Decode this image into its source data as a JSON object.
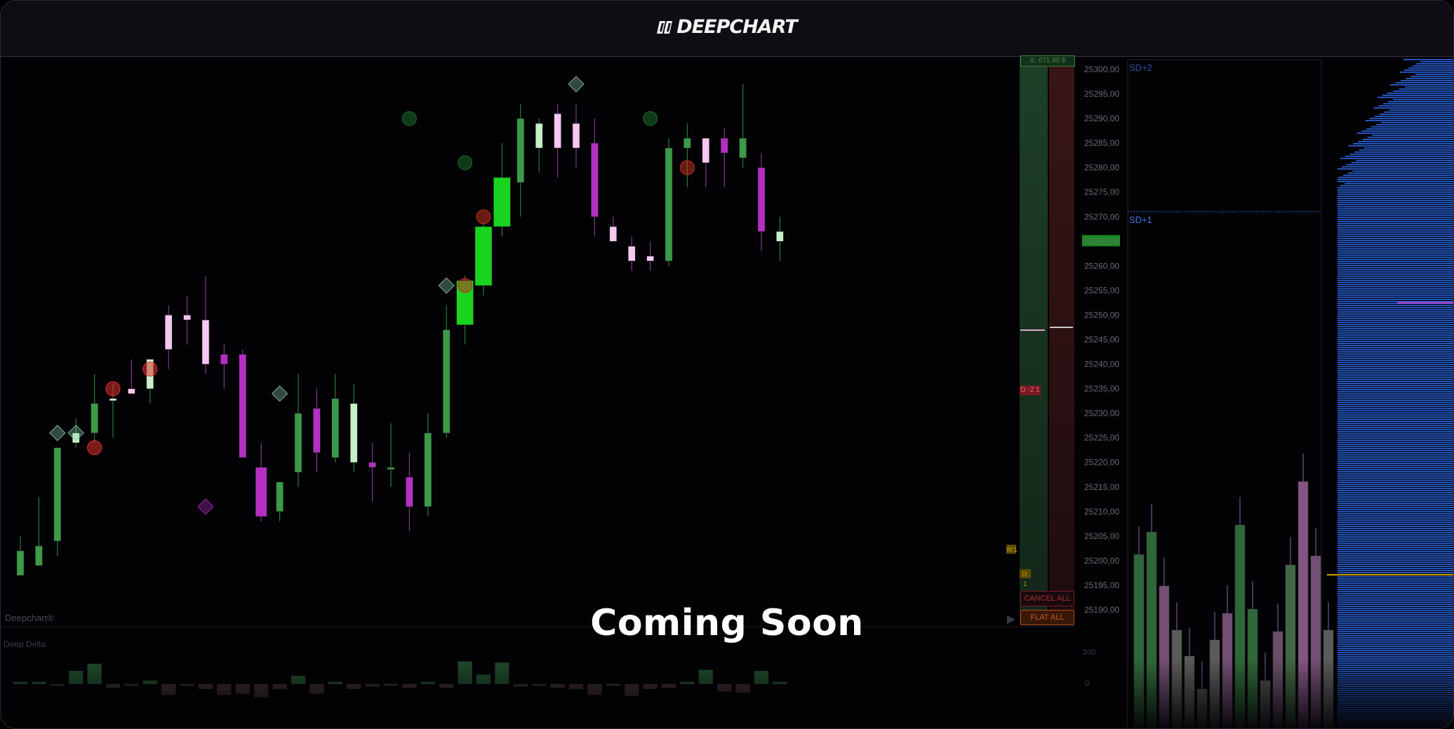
{
  "app": {
    "title": "DEEPCHART",
    "watermark": "Deepchart®",
    "overlay_text": "Coming Soon"
  },
  "colors": {
    "bull": "#3c9a48",
    "bull_bright": "#19d41f",
    "bear": "#b42fc2",
    "bear_light": "#f4c8f1",
    "bull_light": "#c8f0c8",
    "profile": "#2a62d8",
    "poc": "#c8a400"
  },
  "subpanel": {
    "title": "Deep Delta",
    "axis_labels": [
      "200",
      "0"
    ]
  },
  "order_panel": {
    "pnl_label": "Δ: 671,90 $",
    "position_tag": "D -2 1",
    "cancel_all_label": "CANCEL ALL",
    "flat_all_label": "FLAT ALL",
    "qty_tag_1": "W:1",
    "qty_tag_2": "D: 1"
  },
  "price_axis": {
    "labels": [
      "25300,00",
      "25295,00",
      "25290,00",
      "25285,00",
      "25280,00",
      "25275,00",
      "25270,00",
      "25265,00",
      "25260,00",
      "25255,00",
      "25250,00",
      "25245,00",
      "25240,00",
      "25235,00",
      "25230,00",
      "25225,00",
      "25220,00",
      "25215,00",
      "25210,00",
      "25205,00",
      "25200,00",
      "25195,00",
      "25190,00"
    ],
    "current_price": "25265,00"
  },
  "bands": {
    "sd2": "SD+2",
    "sd1": "SD+1"
  },
  "chart_data": {
    "type": "candlestick",
    "ylim": [
      25187,
      25302
    ],
    "candles": [
      {
        "o": 25197,
        "h": 25205,
        "l": 25197,
        "c": 25202,
        "s": "g"
      },
      {
        "o": 25199,
        "h": 25213,
        "l": 25199,
        "c": 25203,
        "s": "g"
      },
      {
        "o": 25204,
        "h": 25223,
        "l": 25201,
        "c": 25223,
        "s": "g"
      },
      {
        "o": 25224,
        "h": 25229,
        "l": 25223,
        "c": 25226,
        "s": "gl"
      },
      {
        "o": 25226,
        "h": 25238,
        "l": 25224,
        "c": 25232,
        "s": "g"
      },
      {
        "o": 25233,
        "h": 25236,
        "l": 25225,
        "c": 25233,
        "s": "w"
      },
      {
        "o": 25234,
        "h": 25241,
        "l": 25234,
        "c": 25235,
        "s": "pl"
      },
      {
        "o": 25235,
        "h": 25240,
        "l": 25232,
        "c": 25241,
        "s": "gl"
      },
      {
        "o": 25250,
        "h": 25252,
        "l": 25239,
        "c": 25243,
        "s": "pl"
      },
      {
        "o": 25249,
        "h": 25254,
        "l": 25244,
        "c": 25250,
        "s": "pl"
      },
      {
        "o": 25249,
        "h": 25258,
        "l": 25238,
        "c": 25240,
        "s": "pl"
      },
      {
        "o": 25242,
        "h": 25244,
        "l": 25235,
        "c": 25240,
        "s": "p"
      },
      {
        "o": 25242,
        "h": 25243,
        "l": 25221,
        "c": 25221,
        "s": "p"
      },
      {
        "o": 25219,
        "h": 25224,
        "l": 25208,
        "c": 25209,
        "s": "p"
      },
      {
        "o": 25210,
        "h": 25216,
        "l": 25208,
        "c": 25216,
        "s": "g"
      },
      {
        "o": 25218,
        "h": 25238,
        "l": 25215,
        "c": 25230,
        "s": "g"
      },
      {
        "o": 25231,
        "h": 25235,
        "l": 25218,
        "c": 25222,
        "s": "p"
      },
      {
        "o": 25221,
        "h": 25238,
        "l": 25220,
        "c": 25233,
        "s": "g"
      },
      {
        "o": 25232,
        "h": 25236,
        "l": 25218,
        "c": 25220,
        "s": "gl"
      },
      {
        "o": 25220,
        "h": 25224,
        "l": 25212,
        "c": 25219,
        "s": "p"
      },
      {
        "o": 25219,
        "h": 25228,
        "l": 25215,
        "c": 25219,
        "s": "g"
      },
      {
        "o": 25217,
        "h": 25222,
        "l": 25206,
        "c": 25211,
        "s": "p"
      },
      {
        "o": 25211,
        "h": 25230,
        "l": 25209,
        "c": 25226,
        "s": "g"
      },
      {
        "o": 25226,
        "h": 25252,
        "l": 25225,
        "c": 25247,
        "s": "g"
      },
      {
        "o": 25248,
        "h": 25258,
        "l": 25244,
        "c": 25257,
        "s": "gb"
      },
      {
        "o": 25256,
        "h": 25269,
        "l": 25254,
        "c": 25268,
        "s": "gb"
      },
      {
        "o": 25268,
        "h": 25285,
        "l": 25266,
        "c": 25278,
        "s": "gb"
      },
      {
        "o": 25277,
        "h": 25293,
        "l": 25270,
        "c": 25290,
        "s": "g"
      },
      {
        "o": 25284,
        "h": 25290,
        "l": 25279,
        "c": 25289,
        "s": "gl"
      },
      {
        "o": 25291,
        "h": 25293,
        "l": 25278,
        "c": 25284,
        "s": "pl"
      },
      {
        "o": 25289,
        "h": 25293,
        "l": 25280,
        "c": 25284,
        "s": "pl"
      },
      {
        "o": 25285,
        "h": 25290,
        "l": 25266,
        "c": 25270,
        "s": "p"
      },
      {
        "o": 25268,
        "h": 25270,
        "l": 25265,
        "c": 25265,
        "s": "pl"
      },
      {
        "o": 25264,
        "h": 25266,
        "l": 25259,
        "c": 25261,
        "s": "pl"
      },
      {
        "o": 25262,
        "h": 25265,
        "l": 25259,
        "c": 25261,
        "s": "pl"
      },
      {
        "o": 25261,
        "h": 25286,
        "l": 25260,
        "c": 25284,
        "s": "g"
      },
      {
        "o": 25284,
        "h": 25289,
        "l": 25276,
        "c": 25286,
        "s": "g"
      },
      {
        "o": 25286,
        "h": 25286,
        "l": 25276,
        "c": 25281,
        "s": "pl"
      },
      {
        "o": 25283,
        "h": 25288,
        "l": 25276,
        "c": 25286,
        "s": "p"
      },
      {
        "o": 25282,
        "h": 25297,
        "l": 25280,
        "c": 25286,
        "s": "g"
      },
      {
        "o": 25280,
        "h": 25283,
        "l": 25263,
        "c": 25267,
        "s": "p"
      },
      {
        "o": 25265,
        "h": 25270,
        "l": 25261,
        "c": 25267,
        "s": "gl"
      }
    ],
    "delta": [
      4,
      4,
      -2,
      22,
      34,
      -6,
      -2,
      6,
      -18,
      -2,
      -8,
      -18,
      -16,
      -22,
      -8,
      14,
      -16,
      4,
      -8,
      -4,
      0,
      -6,
      4,
      -6,
      38,
      16,
      36,
      -4,
      -2,
      -6,
      -8,
      -18,
      0,
      -20,
      -8,
      -6,
      4,
      24,
      -12,
      -14,
      22,
      4
    ]
  }
}
